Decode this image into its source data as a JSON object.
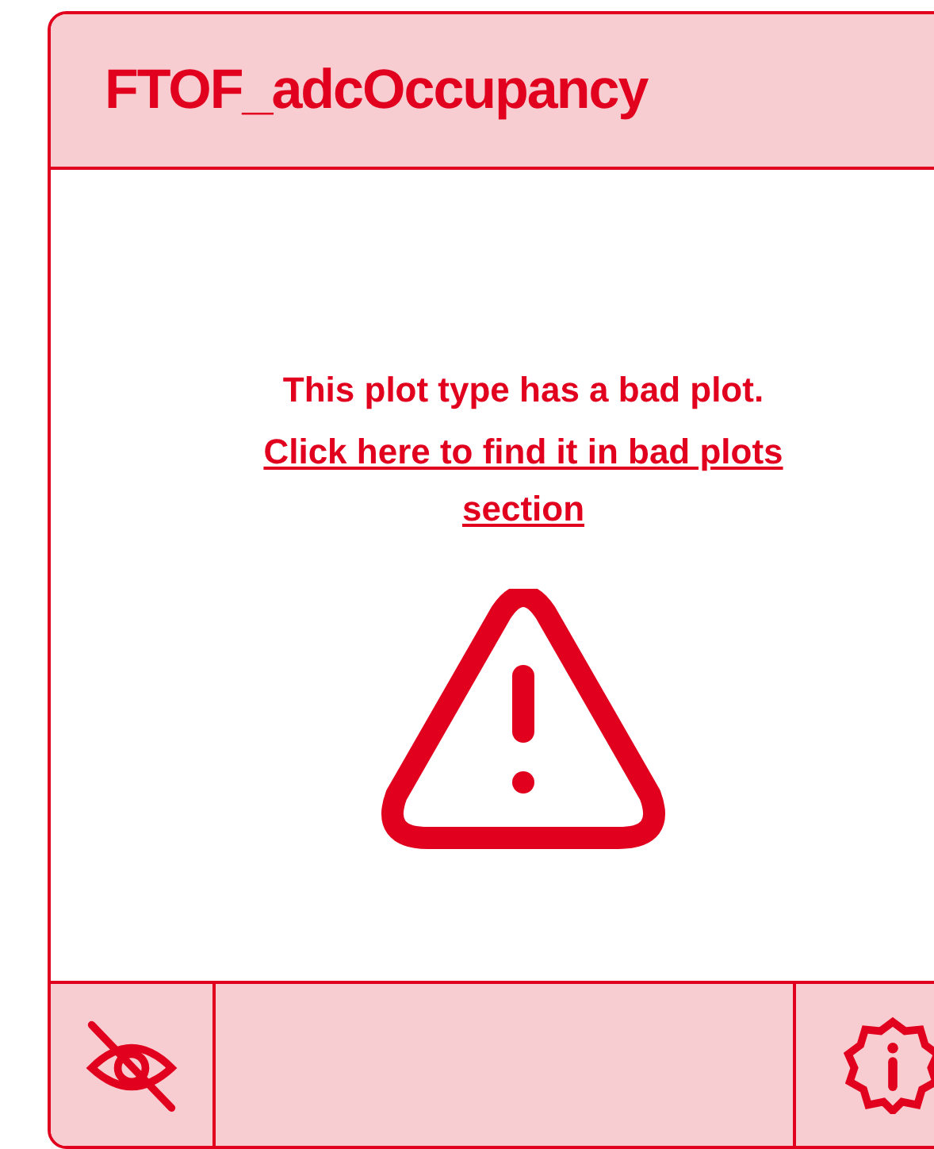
{
  "card": {
    "title": "FTOF_adcOccupancy",
    "message": "This plot type has a bad plot.",
    "link": "Click here to find it in bad plots section"
  }
}
